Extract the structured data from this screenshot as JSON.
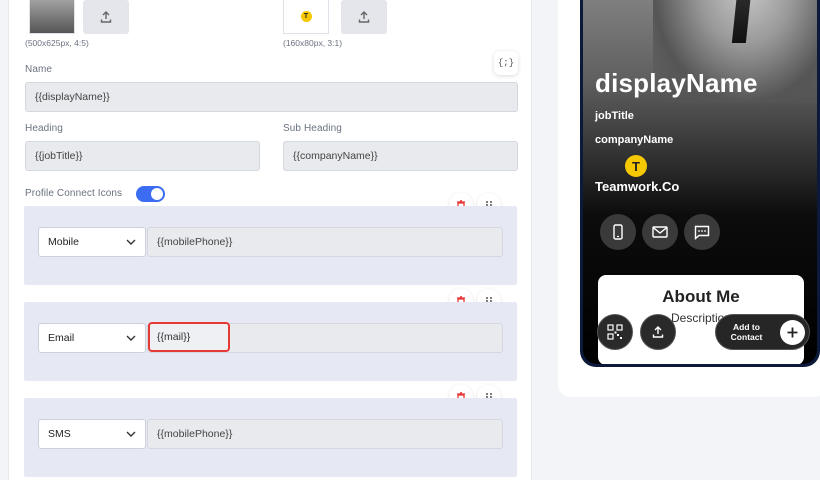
{
  "images": {
    "profile_caption": "(500x625px, 4:5)",
    "logo_caption": "(160x80px, 3:1)",
    "logo_letter": "T"
  },
  "form": {
    "name_label": "Name",
    "name_value": "{{displayName}}",
    "heading_label": "Heading",
    "heading_value": "{{jobTitle}}",
    "subheading_label": "Sub Heading",
    "subheading_value": "{{companyName}}",
    "variables_badge": "{;}",
    "connect_icons_label": "Profile Connect Icons",
    "connect_icons_enabled": true
  },
  "connect_rows": [
    {
      "type": "Mobile",
      "value": "{{mobilePhone}}"
    },
    {
      "type": "Email",
      "value": "{{mail}}"
    },
    {
      "type": "SMS",
      "value": "{{mobilePhone}}"
    }
  ],
  "preview": {
    "display_name": "displayName",
    "job_title": "jobTitle",
    "company_name": "companyName",
    "logo_letter": "T",
    "brand": "Teamwork.Co",
    "about_title": "About Me",
    "about_desc": "Description",
    "add_contact_label": "Add to Contact"
  },
  "colors": {
    "accent": "#3b6cf2",
    "highlight": "#e53935",
    "logo": "#f6c800",
    "phone_frame": "#0b1a3a"
  }
}
